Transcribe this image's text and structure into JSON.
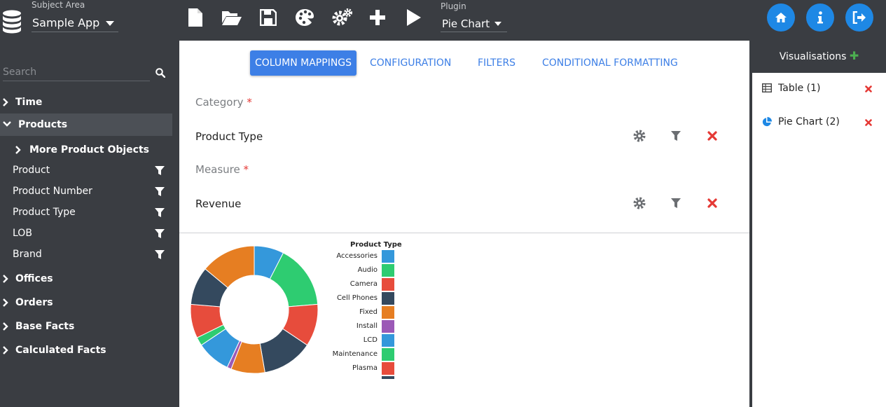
{
  "subject_area": {
    "label": "Subject Area",
    "value": "Sample App"
  },
  "plugin": {
    "label": "Plugin",
    "value": "Pie Chart"
  },
  "toolbar": [
    "new-file-icon",
    "open-folder-icon",
    "save-icon",
    "palette-icon",
    "cogs-icon",
    "plus-icon",
    "play-icon"
  ],
  "nav_buttons": [
    "home-icon",
    "info-icon",
    "sign-out-icon"
  ],
  "search": {
    "placeholder": "Search"
  },
  "tree": {
    "time": "Time",
    "products": "Products",
    "more_product_objects": "More Product Objects",
    "product": "Product",
    "product_number": "Product Number",
    "product_type": "Product Type",
    "lob": "LOB",
    "brand": "Brand",
    "offices": "Offices",
    "orders": "Orders",
    "base_facts": "Base Facts",
    "calculated_facts": "Calculated Facts"
  },
  "tabs": {
    "column_mappings": "COLUMN MAPPINGS",
    "configuration": "CONFIGURATION",
    "filters": "FILTERS",
    "conditional_formatting": "CONDITIONAL FORMATTING"
  },
  "mappings": {
    "category_label": "Category",
    "category_value": "Product Type",
    "measure_label": "Measure",
    "measure_value": "Revenue",
    "required_mark": "*"
  },
  "chart_data": {
    "type": "pie",
    "legend_title": "Product Type",
    "categories": [
      "Accessories",
      "Audio",
      "Camera",
      "Cell Phones",
      "Fixed",
      "Install",
      "LCD",
      "Maintenance",
      "Plasma"
    ],
    "colors": [
      "#3498db",
      "#2ecc71",
      "#e74c3c",
      "#34495e",
      "#e67e22",
      "#9b59b6",
      "#3498db",
      "#2ecc71",
      "#e74c3c"
    ],
    "slices": [
      {
        "category": "Accessories",
        "value": 7,
        "color": "#3498db"
      },
      {
        "category": "Audio",
        "value": 15,
        "color": "#2ecc71"
      },
      {
        "category": "Camera",
        "value": 10,
        "color": "#e74c3c"
      },
      {
        "category": "Cell Phones",
        "value": 12,
        "color": "#34495e"
      },
      {
        "category": "Fixed",
        "value": 8,
        "color": "#e67e22"
      },
      {
        "category": "Install",
        "value": 1,
        "color": "#9b59b6"
      },
      {
        "category": "LCD",
        "value": 8,
        "color": "#3498db"
      },
      {
        "category": "Maintenance",
        "value": 2,
        "color": "#2ecc71"
      },
      {
        "category": "Plasma",
        "value": 8,
        "color": "#e74c3c"
      },
      {
        "category": "",
        "value": 9,
        "color": "#34495e"
      },
      {
        "category": "",
        "value": 13,
        "color": "#e67e22"
      }
    ],
    "donut": true
  },
  "visualisations": {
    "title": "Visualisations",
    "add": "✚",
    "items": [
      {
        "label": "Table (1)",
        "icon": "table-icon"
      },
      {
        "label": "Pie Chart (2)",
        "icon": "pie-chart-icon"
      }
    ],
    "delete": "✖"
  },
  "colors": {
    "accent": "#3d7fe6",
    "topbar": "#3a3d42",
    "nav_button": "#1e88e5",
    "delete": "#e53935",
    "add": "#4caf50"
  }
}
